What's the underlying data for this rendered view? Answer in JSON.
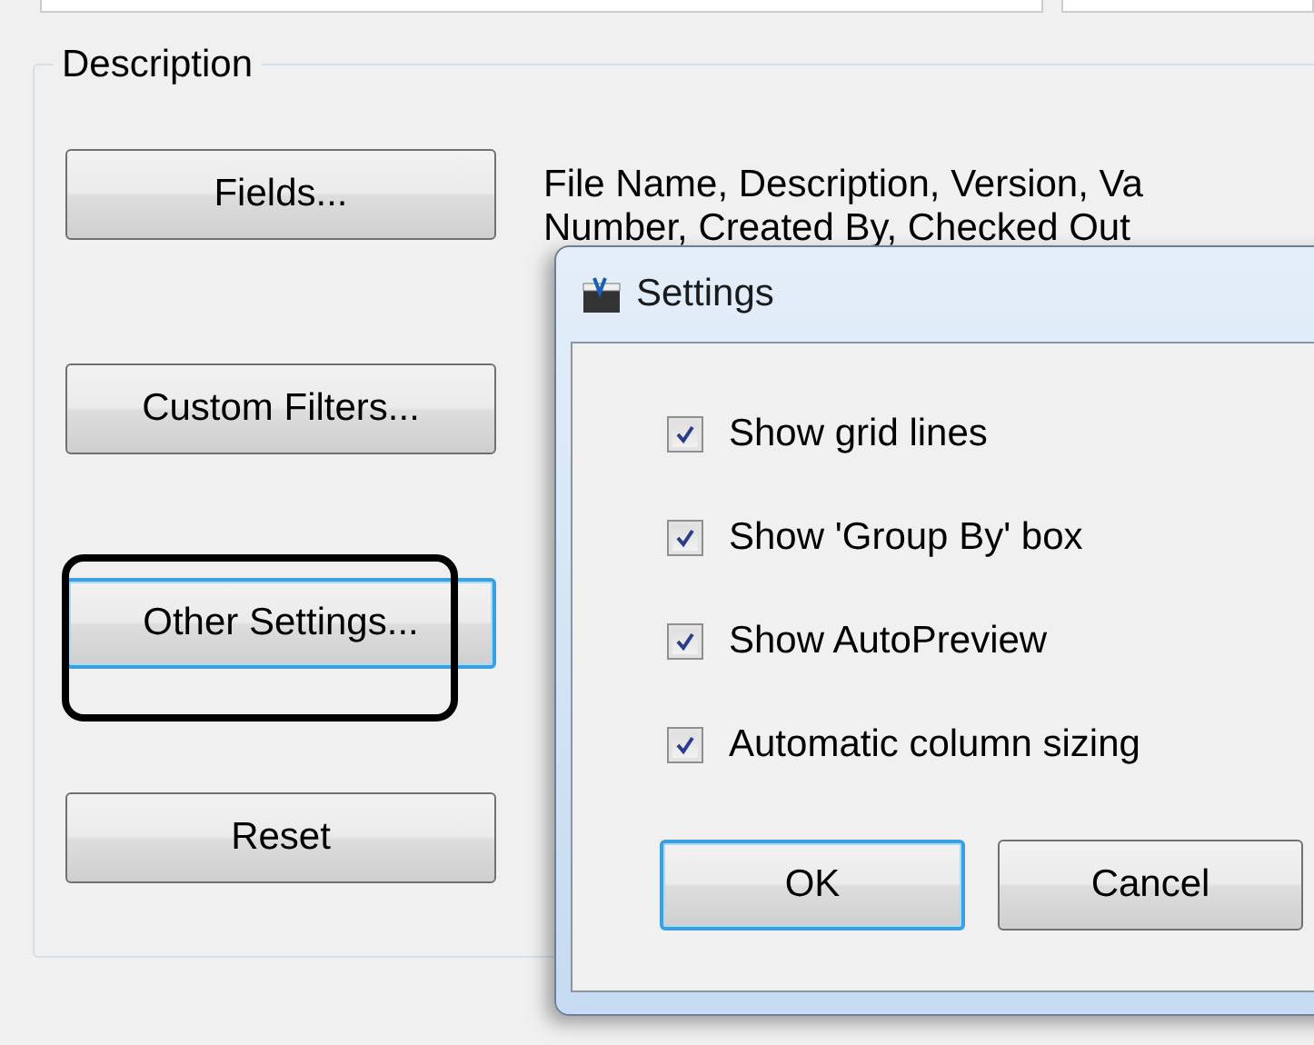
{
  "group": {
    "title": "Description"
  },
  "buttons": [
    {
      "label": "Fields...",
      "focused": false
    },
    {
      "label": "Custom Filters...",
      "focused": false
    },
    {
      "label": "Other Settings...",
      "focused": true
    },
    {
      "label": "Reset",
      "focused": false
    }
  ],
  "description_lines": [
    "File Name, Description, Version, Va",
    "Number, Created By, Checked Out"
  ],
  "dialog": {
    "title": "Settings",
    "options": [
      {
        "label": "Show grid lines",
        "checked": true
      },
      {
        "label": "Show 'Group By' box",
        "checked": true
      },
      {
        "label": "Show AutoPreview",
        "checked": true
      },
      {
        "label": "Automatic column sizing",
        "checked": true
      }
    ],
    "buttons": [
      {
        "label": "OK",
        "focused": true
      },
      {
        "label": "Cancel",
        "focused": false
      }
    ]
  }
}
